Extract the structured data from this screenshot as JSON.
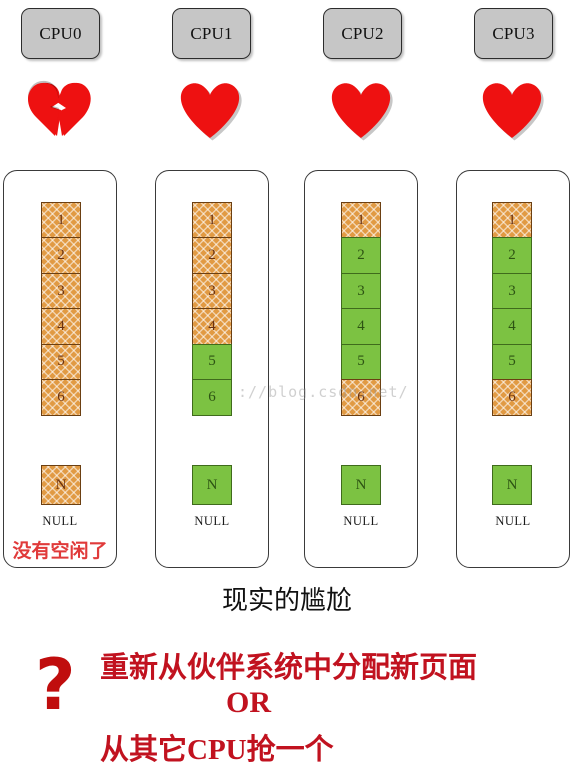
{
  "diagram": {
    "title_caption": "现实的尴尬",
    "watermark": "://blog.csdn.net/",
    "null_label": "NULL",
    "colors": {
      "used_cell": "#e19a43",
      "free_cell": "#7cc242",
      "chip": "#c6c6c6",
      "heart": "#ee1111",
      "warning_red": "#e03a3a",
      "bottom_red": "#c1121f"
    },
    "cpus": [
      {
        "label": "CPU0",
        "heart": "broken-heart",
        "cells": [
          {
            "num": "1",
            "state": "used"
          },
          {
            "num": "2",
            "state": "used"
          },
          {
            "num": "3",
            "state": "used"
          },
          {
            "num": "4",
            "state": "used"
          },
          {
            "num": "5",
            "state": "used"
          },
          {
            "num": "6",
            "state": "used"
          }
        ],
        "null_node": {
          "num": "N",
          "state": "used"
        },
        "warning": "没有空闲了"
      },
      {
        "label": "CPU1",
        "heart": "heart",
        "cells": [
          {
            "num": "1",
            "state": "used"
          },
          {
            "num": "2",
            "state": "used"
          },
          {
            "num": "3",
            "state": "used"
          },
          {
            "num": "4",
            "state": "used"
          },
          {
            "num": "5",
            "state": "free"
          },
          {
            "num": "6",
            "state": "free"
          }
        ],
        "null_node": {
          "num": "N",
          "state": "free"
        },
        "warning": ""
      },
      {
        "label": "CPU2",
        "heart": "heart",
        "cells": [
          {
            "num": "1",
            "state": "used"
          },
          {
            "num": "2",
            "state": "free"
          },
          {
            "num": "3",
            "state": "free"
          },
          {
            "num": "4",
            "state": "free"
          },
          {
            "num": "5",
            "state": "free"
          },
          {
            "num": "6",
            "state": "used"
          }
        ],
        "null_node": {
          "num": "N",
          "state": "free"
        },
        "warning": ""
      },
      {
        "label": "CPU3",
        "heart": "heart",
        "cells": [
          {
            "num": "1",
            "state": "used"
          },
          {
            "num": "2",
            "state": "free"
          },
          {
            "num": "3",
            "state": "free"
          },
          {
            "num": "4",
            "state": "free"
          },
          {
            "num": "5",
            "state": "free"
          },
          {
            "num": "6",
            "state": "used"
          }
        ],
        "null_node": {
          "num": "N",
          "state": "free"
        },
        "warning": ""
      }
    ],
    "bottom": {
      "question_mark": "?",
      "option_1": "重新从伙伴系统中分配新页面",
      "separator": "OR",
      "option_2": "从其它CPU抢一个"
    }
  }
}
